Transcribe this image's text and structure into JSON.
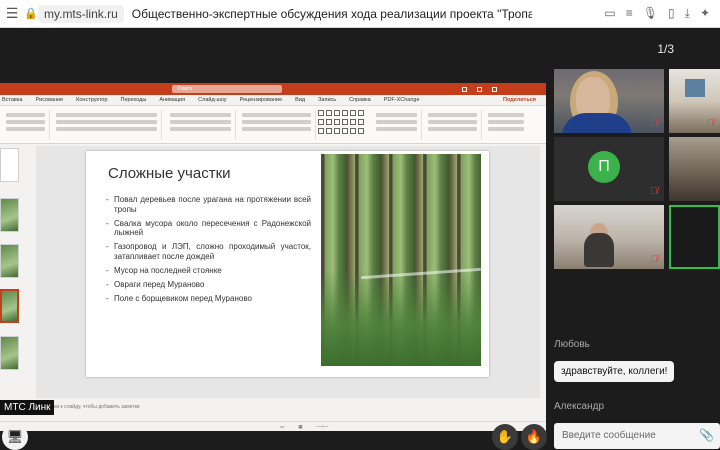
{
  "browser": {
    "menu_icon": "hamburger-icon",
    "url": "my.mts-link.ru",
    "tab_title": "Общественно-экспертные обсуждения хода реализации проекта \"Тропа поэтов..."
  },
  "viewer": {
    "page_counter": "1/3"
  },
  "powerpoint": {
    "search_placeholder": "Поиск",
    "tabs": [
      "Вставка",
      "Рисование",
      "Конструктор",
      "Переходы",
      "Анимация",
      "Слайд-шоу",
      "Рецензирование",
      "Вид",
      "Запись",
      "Справка",
      "PDF-XChange"
    ],
    "share_label": "Поделиться",
    "notes_placeholder": "Заметки к слайду, чтобы добавить заметки",
    "accent_color": "#c43e1c"
  },
  "slide": {
    "title": "Сложные участки",
    "bullets": [
      "Повал деревьев после урагана на протяжении всей тропы",
      "Свалка мусора около пересечения с Радонежской лыжней",
      "Газопровод и ЛЭП, сложно проходимый участок, затапливает после дождей",
      "Мусор на последней стоянке",
      "Овраги перед Мураново",
      "Поле с борщевиком перед Мураново"
    ]
  },
  "participants": {
    "avatar_letter": "П",
    "avatar_color": "#3bb34a",
    "muted_icon": "mic-muted-icon"
  },
  "chat": {
    "sender1": "Любовь",
    "message1": "здравствуйте, коллеги!",
    "sender2": "Александр",
    "input_placeholder": "Введите сообщение"
  },
  "footer": {
    "brand": "МТС Линк"
  }
}
